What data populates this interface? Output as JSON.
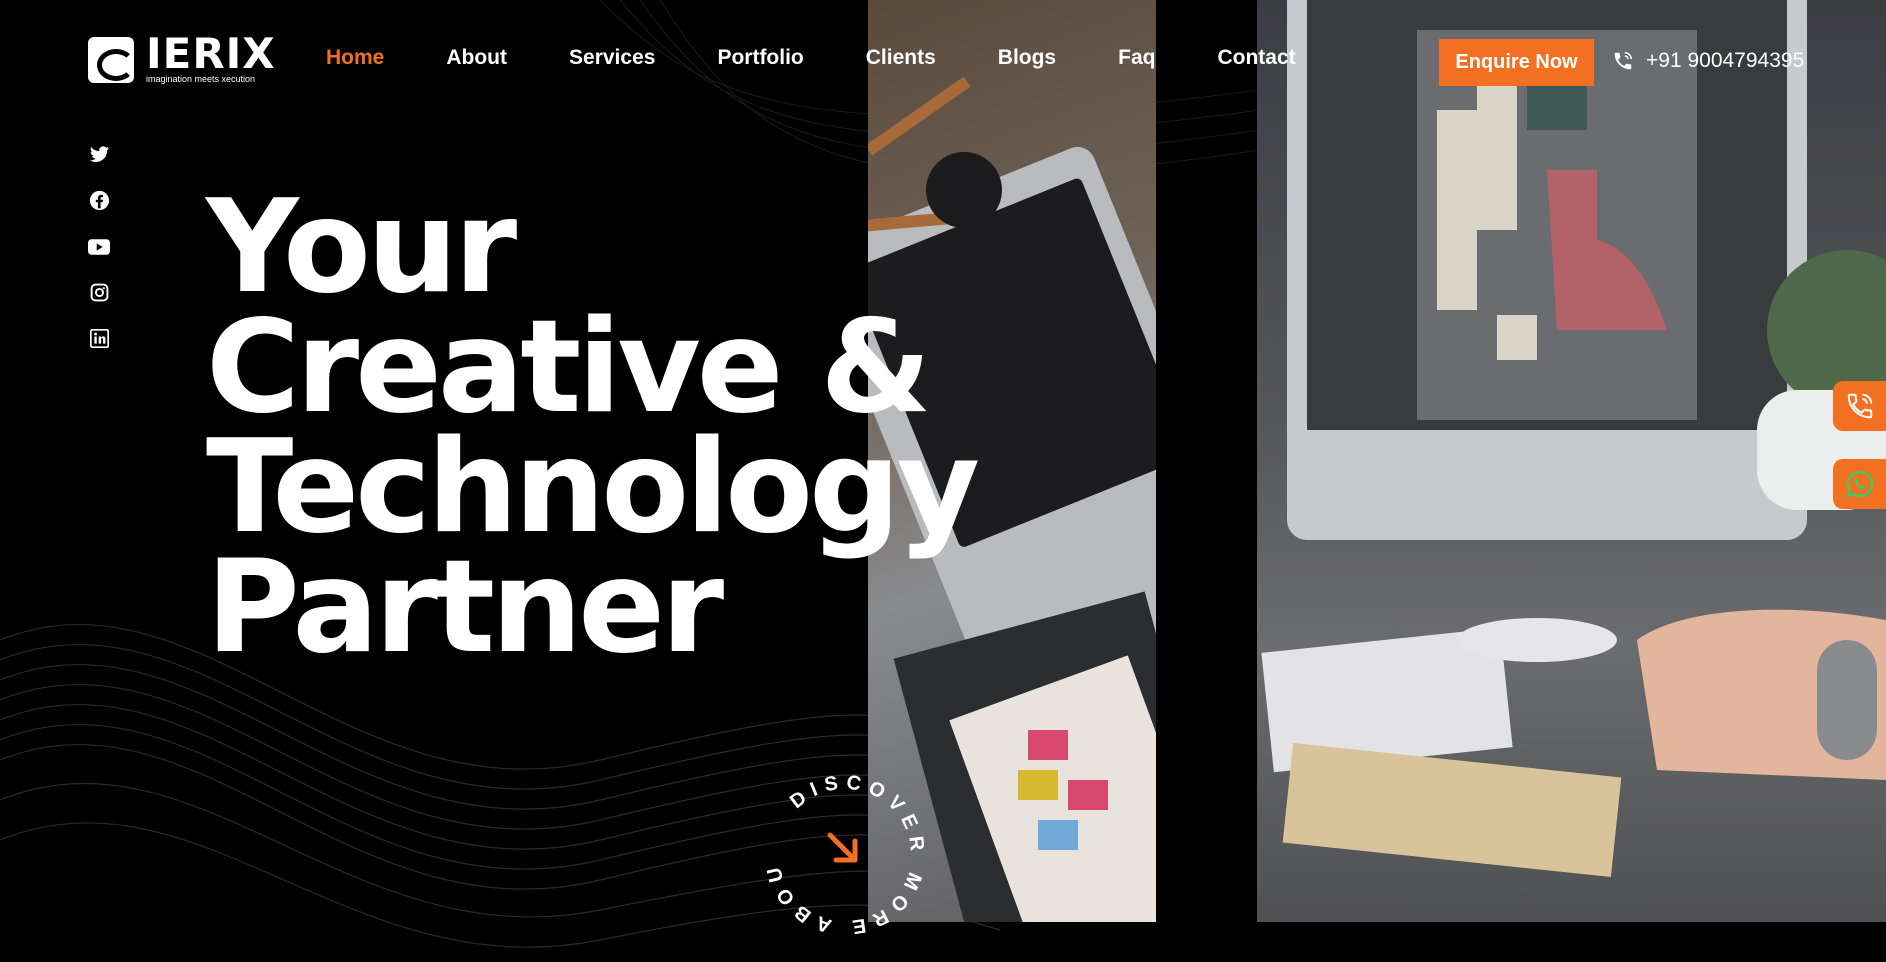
{
  "brand": {
    "name": "IERIX",
    "tagline": "imagination meets xecution",
    "accent": "#f36f21"
  },
  "nav": {
    "items": [
      {
        "label": "Home",
        "active": true
      },
      {
        "label": "About",
        "active": false
      },
      {
        "label": "Services",
        "active": false
      },
      {
        "label": "Portfolio",
        "active": false
      },
      {
        "label": "Clients",
        "active": false
      },
      {
        "label": "Blogs",
        "active": false
      },
      {
        "label": "Faq",
        "active": false
      },
      {
        "label": "Contact",
        "active": false
      }
    ]
  },
  "header": {
    "enquire_label": "Enquire Now",
    "phone": "+91 9004794395",
    "phone_icon": "phone-icon"
  },
  "social": [
    "twitter-icon",
    "facebook-icon",
    "youtube-icon",
    "instagram-icon",
    "linkedin-icon"
  ],
  "hero": {
    "lines": [
      "Your",
      "Creative &",
      "Technology",
      "Partner"
    ],
    "discover_text": "DISCOVER MORE ABOUT US",
    "discover_icon": "arrow-down-right-icon"
  },
  "floating": {
    "call_icon": "phone-call-icon",
    "whatsapp_icon": "whatsapp-icon"
  }
}
